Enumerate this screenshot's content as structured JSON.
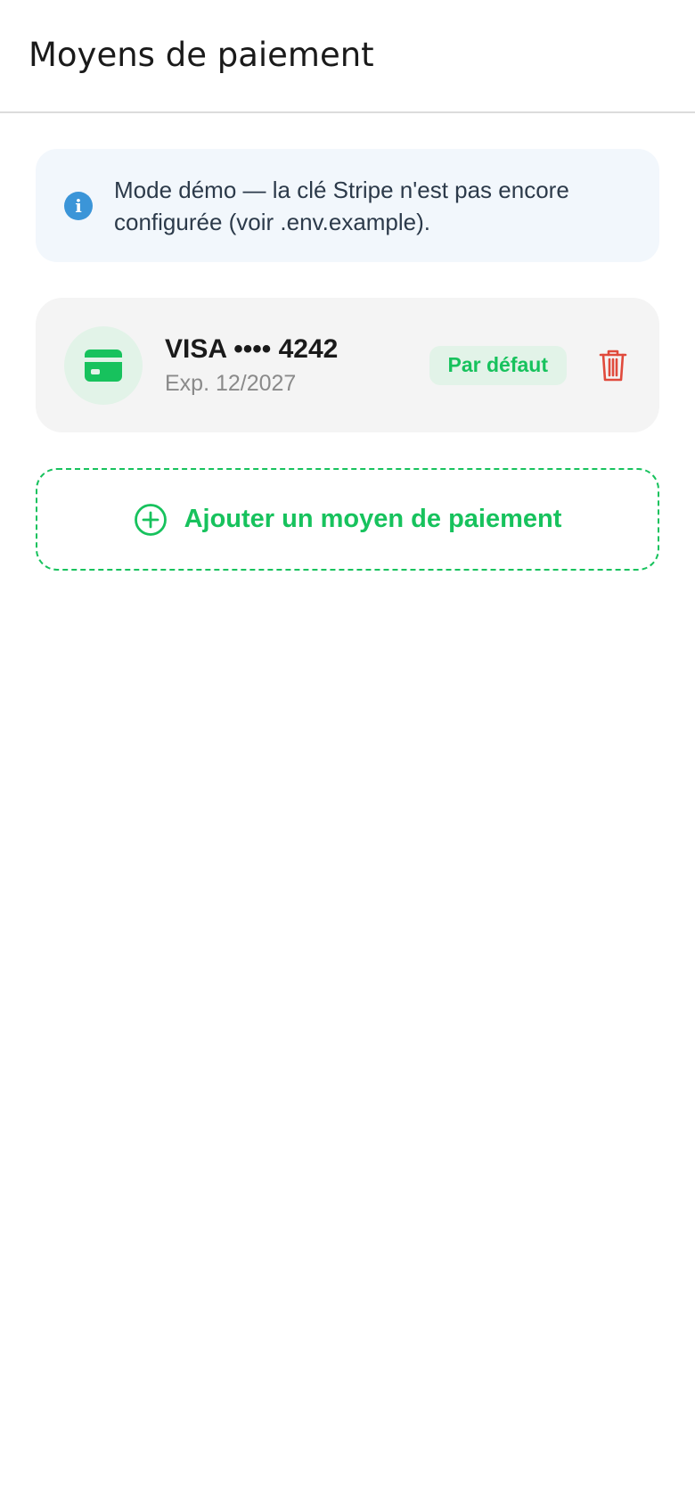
{
  "header": {
    "title": "Moyens de paiement"
  },
  "info_banner": {
    "icon": "info-icon",
    "text_line1": "Mode démo — la clé Stripe n'est pas encore",
    "text_line2": "configurée (voir .env.example)."
  },
  "payment_methods": [
    {
      "brand_label": "VISA •••• 4242",
      "expiry": "Exp. 12/2027",
      "badge": "Par défaut",
      "icon": "credit-card-icon",
      "delete_icon": "trash-icon"
    }
  ],
  "add_button": {
    "label": "Ajouter un moyen de paiement",
    "icon": "plus-circle-icon"
  },
  "colors": {
    "accent": "#17c25d",
    "info": "#3b95d8",
    "danger": "#e04a3c"
  }
}
